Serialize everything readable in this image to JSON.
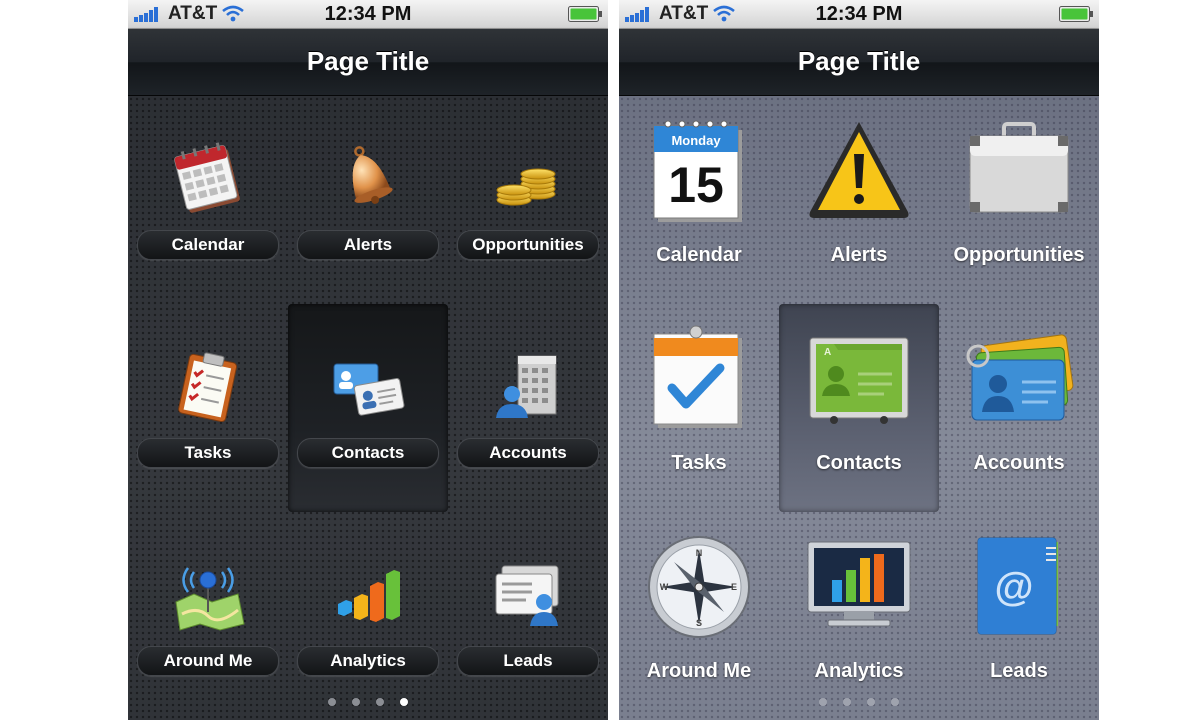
{
  "status_bar": {
    "carrier": "AT&T",
    "time": "12:34 PM"
  },
  "nav": {
    "title": "Page Title"
  },
  "grid": {
    "items": [
      {
        "label": "Calendar",
        "icon": "calendar-icon"
      },
      {
        "label": "Alerts",
        "icon": "bell-icon"
      },
      {
        "label": "Opportunities",
        "icon": "coins-icon"
      },
      {
        "label": "Tasks",
        "icon": "clipboard-icon"
      },
      {
        "label": "Contacts",
        "icon": "contact-cards-icon"
      },
      {
        "label": "Accounts",
        "icon": "building-user-icon"
      },
      {
        "label": "Around Me",
        "icon": "map-pin-icon"
      },
      {
        "label": "Analytics",
        "icon": "bar-chart-icon"
      },
      {
        "label": "Leads",
        "icon": "lead-card-icon"
      }
    ],
    "selected_index": 4
  },
  "light_calendar": {
    "weekday": "Monday",
    "day": "15"
  },
  "light_compass": {
    "north": "N",
    "south": "S",
    "east": "E",
    "west": "W"
  },
  "light_contacts": {
    "tab_letter": "A"
  },
  "light_leads": {
    "symbol": "@"
  },
  "pager": {
    "pages": 4,
    "current": 4
  },
  "colors": {
    "dark_background": "#2b2e33",
    "light_background": "#777c8c",
    "nav_bar": "#20242a",
    "active_dot": "#ffffff"
  }
}
